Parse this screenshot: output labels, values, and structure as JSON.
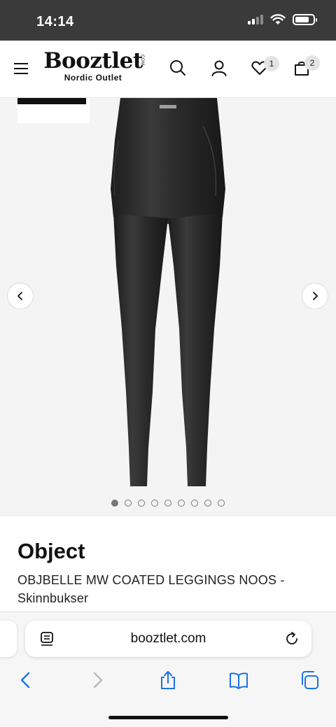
{
  "status_bar": {
    "time": "14:14",
    "battery_level": 0.8,
    "signal_bars_active": 2,
    "signal_bars_total": 4
  },
  "header": {
    "logo_main": "Booztlet",
    "logo_com": ".COM",
    "logo_sub": "Nordic Outlet",
    "wishlist_count": "1",
    "cart_count": "2",
    "icons": [
      "menu-icon",
      "search-icon",
      "account-icon",
      "heart-icon",
      "shopping-bag-icon"
    ]
  },
  "gallery": {
    "image_count": 9,
    "active_index": 0,
    "background_color": "#f4f4f4",
    "product_color": "#2b2b2b"
  },
  "product": {
    "brand": "Object",
    "name": "OBJBELLE MW COATED LEGGINGS NOOS - Skinnbukser"
  },
  "browser": {
    "url": "booztlet.com",
    "accent_color": "#1a73e8",
    "icons": [
      "reader-icon",
      "reload-icon",
      "back-icon",
      "forward-icon",
      "share-icon",
      "bookmarks-icon",
      "tabs-icon"
    ]
  }
}
